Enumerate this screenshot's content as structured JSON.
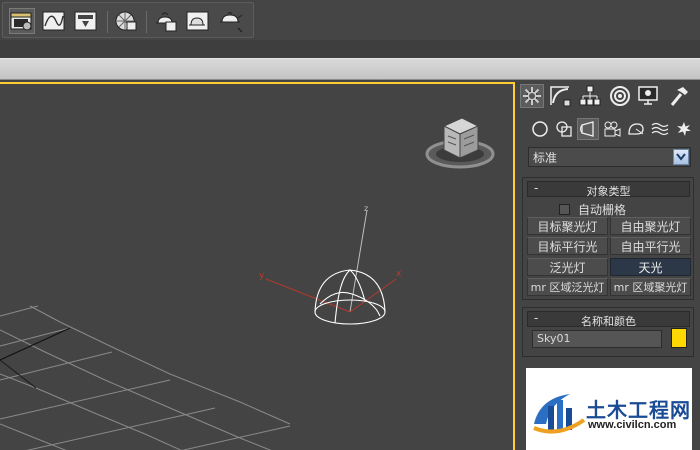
{
  "toolbar": {
    "buttons": [
      "scene-explorer",
      "curve-editor",
      "render-to-texture",
      "material-editor",
      "render-setup",
      "rendered-frame-window",
      "render-production"
    ]
  },
  "viewport": {
    "axes": {
      "x": "x",
      "y": "y",
      "z": "z"
    },
    "object": "Sky01",
    "colors": {
      "grid": "#8a8a8a",
      "x_axis": "#b03a2e",
      "sky_helper": "#ffffff",
      "active_border": "#ffcc33"
    }
  },
  "command_panel": {
    "tabs": [
      "create",
      "modify",
      "hierarchy",
      "motion",
      "display",
      "utilities"
    ],
    "subtabs": [
      "geometry",
      "shapes",
      "lights",
      "cameras",
      "helpers",
      "space-warps",
      "systems"
    ],
    "category": "标准",
    "object_type": {
      "title": "对象类型",
      "collapse": "-",
      "autogrid_label": "自动栅格",
      "buttons": [
        {
          "label": "目标聚光灯",
          "selected": false
        },
        {
          "label": "自由聚光灯",
          "selected": false
        },
        {
          "label": "目标平行光",
          "selected": false
        },
        {
          "label": "自由平行光",
          "selected": false
        },
        {
          "label": "泛光灯",
          "selected": false
        },
        {
          "label": "天光",
          "selected": true
        },
        {
          "label": "mr 区域泛光灯",
          "selected": false
        },
        {
          "label": "mr 区域聚光灯",
          "selected": false
        }
      ]
    },
    "name_color": {
      "title": "名称和颜色",
      "collapse": "-",
      "name_value": "Sky01",
      "color": "#ffd800"
    }
  },
  "watermark": {
    "title": "土木工程网",
    "url": "www.civilcn.com"
  }
}
